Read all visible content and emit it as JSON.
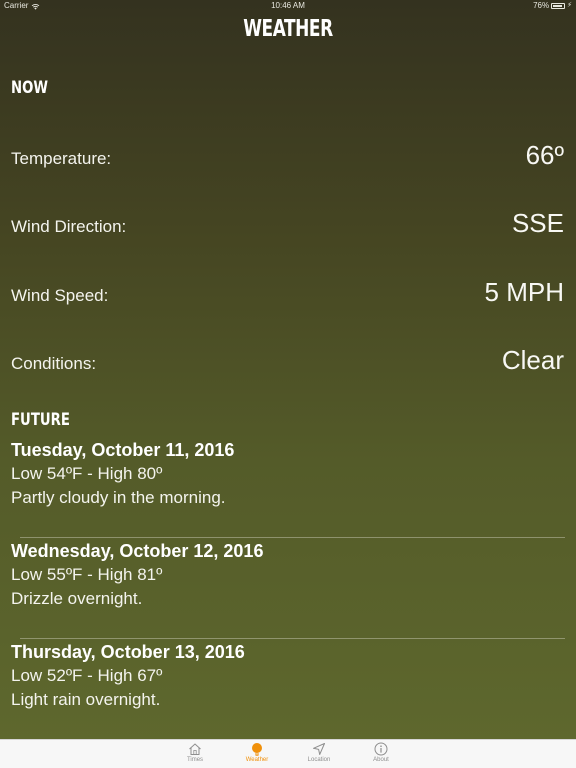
{
  "status_bar": {
    "carrier": "Carrier",
    "time": "10:46 AM",
    "battery": "76%"
  },
  "header": {
    "title": "WEATHER"
  },
  "now": {
    "heading": "NOW",
    "rows": [
      {
        "label": "Temperature:",
        "value": "66º"
      },
      {
        "label": "Wind Direction:",
        "value": "SSE"
      },
      {
        "label": "Wind Speed:",
        "value": "5 MPH"
      },
      {
        "label": "Conditions:",
        "value": "Clear"
      }
    ]
  },
  "future": {
    "heading": "FUTURE",
    "days": [
      {
        "date": "Tuesday, October 11, 2016",
        "range": "Low 54ºF - High 80º",
        "summary": "Partly cloudy in the morning."
      },
      {
        "date": "Wednesday, October 12, 2016",
        "range": "Low 55ºF - High 81º",
        "summary": "Drizzle overnight."
      },
      {
        "date": "Thursday, October 13, 2016",
        "range": "Low 52ºF - High 67º",
        "summary": "Light rain overnight."
      }
    ]
  },
  "tabs": [
    {
      "label": "Times",
      "icon": "house-icon"
    },
    {
      "label": "Weather",
      "icon": "sun-icon"
    },
    {
      "label": "Location",
      "icon": "location-arrow-icon"
    },
    {
      "label": "About",
      "icon": "info-icon"
    }
  ],
  "colors": {
    "accent": "#f0900a",
    "tab_inactive": "#8e8e8e",
    "tabbar_bg": "#f7f7f7"
  }
}
